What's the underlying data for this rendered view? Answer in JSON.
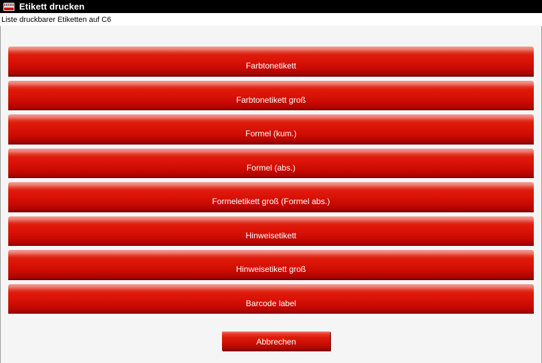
{
  "window": {
    "title": "Etikett drucken",
    "icon": "app-icon"
  },
  "subtitle": "Liste druckbarer Etiketten auf C6",
  "labels": [
    {
      "label": "Farbtonetikett"
    },
    {
      "label": "Farbtonetikett groß"
    },
    {
      "label": "Formel (kum.)"
    },
    {
      "label": "Formel (abs.)"
    },
    {
      "label": "Formeletikett groß (Formel abs.)"
    },
    {
      "label": "Hinweisetikett"
    },
    {
      "label": "Hinweisetikett groß"
    },
    {
      "label": "Barcode label"
    }
  ],
  "actions": {
    "cancel_label": "Abbrechen"
  },
  "colors": {
    "titlebar": "#000000",
    "button_red": "#d81206",
    "button_text": "#ffffff",
    "panel_background": "#f5f5f5"
  }
}
